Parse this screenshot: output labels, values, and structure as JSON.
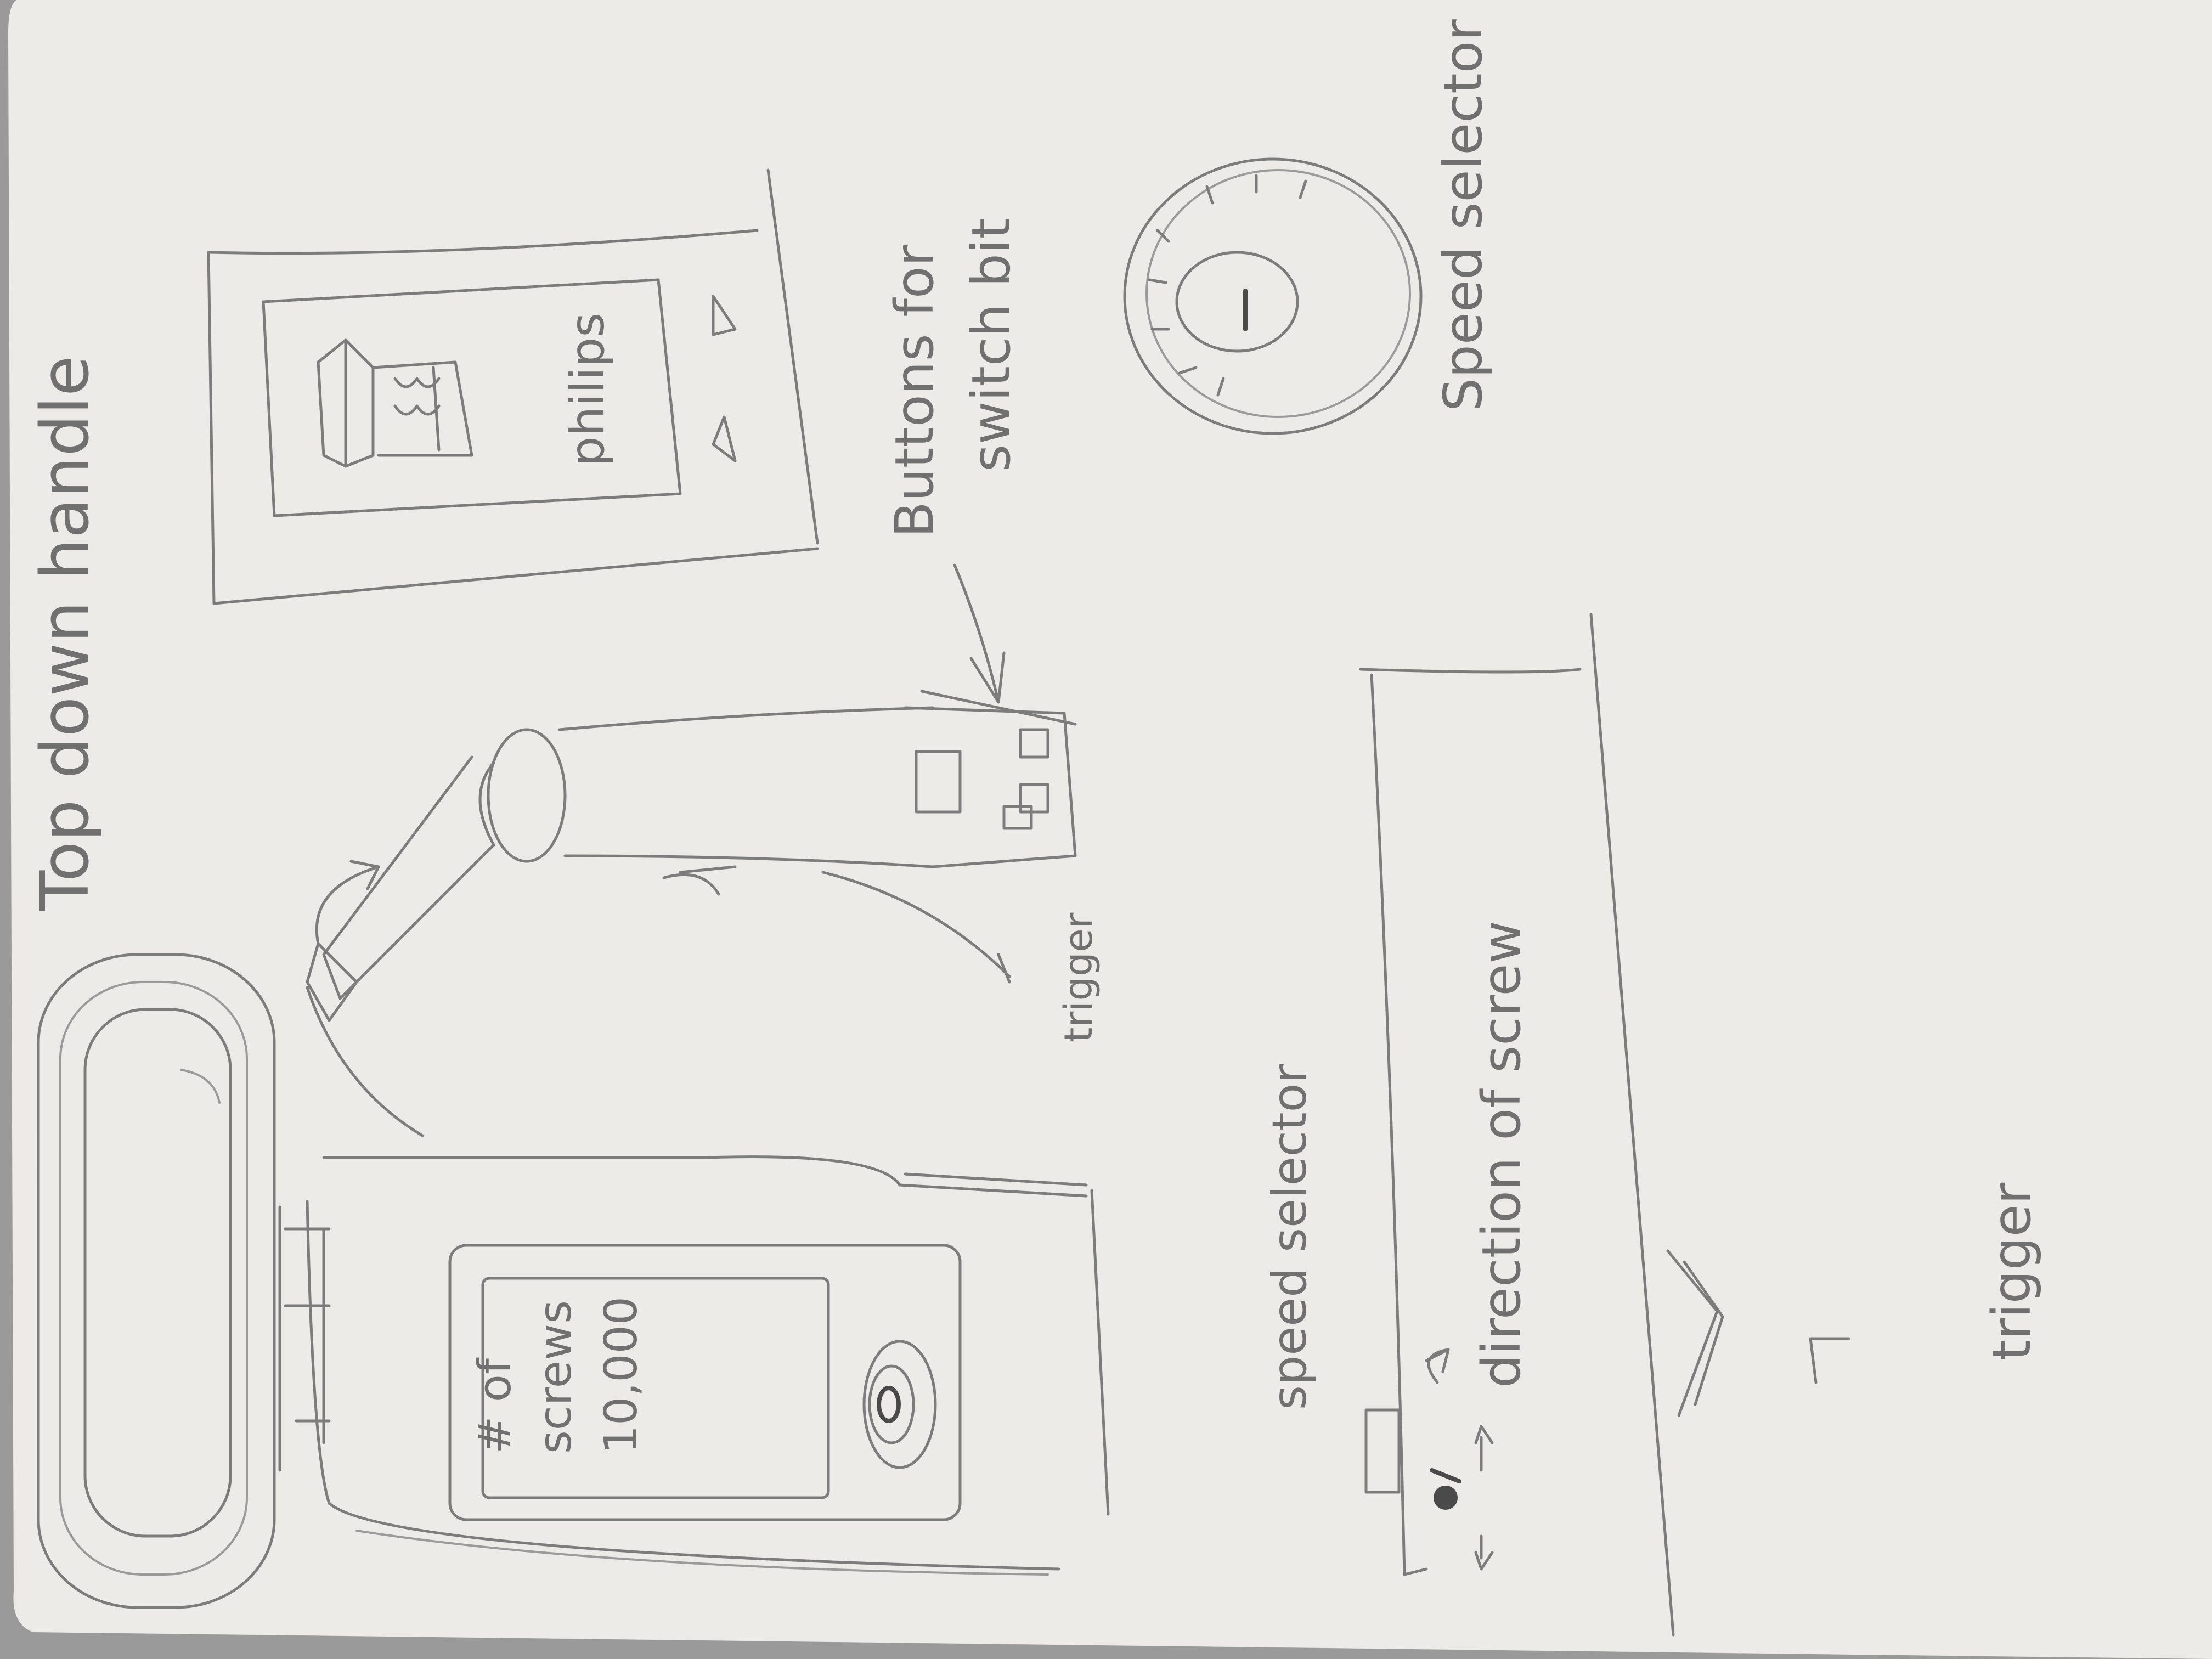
{
  "labels": {
    "top_down_handle": "Top down handle",
    "philips": "philips",
    "buttons_for": "Buttons for",
    "switch_bit": "switch bit",
    "trigger_small": "trigger",
    "speed_selector_top": "Speed selector",
    "speed_selector_side": "speed selector",
    "direction_of_screw": "direction of screw",
    "trigger_side": "trigger",
    "screws_line1": "# of",
    "screws_line2": "screws",
    "screws_count": "10,000"
  },
  "colors": {
    "paper": "#ecebe8",
    "pencil": "#7c7c7c",
    "background": "#9a9a9a"
  }
}
